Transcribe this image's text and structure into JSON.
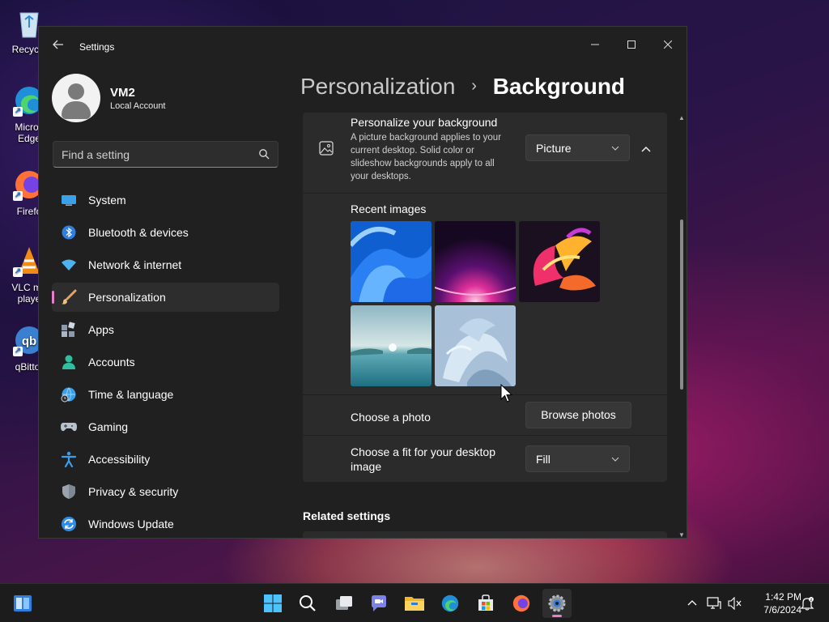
{
  "desktop": {
    "icons": [
      {
        "label": "Recycle"
      },
      {
        "label": "Micros Edge"
      },
      {
        "label": "Firefo"
      },
      {
        "label": "VLC me playe"
      },
      {
        "label": "qBittor"
      }
    ]
  },
  "window": {
    "title": "Settings",
    "controls": {
      "minimize": "—",
      "maximize": "☐",
      "close": "✕"
    }
  },
  "profile": {
    "name": "VM2",
    "account_type": "Local Account"
  },
  "search": {
    "placeholder": "Find a setting"
  },
  "nav": {
    "items": [
      {
        "label": "System",
        "icon": "system-icon"
      },
      {
        "label": "Bluetooth & devices",
        "icon": "bluetooth-icon"
      },
      {
        "label": "Network & internet",
        "icon": "network-icon"
      },
      {
        "label": "Personalization",
        "icon": "brush-icon",
        "active": true
      },
      {
        "label": "Apps",
        "icon": "apps-icon"
      },
      {
        "label": "Accounts",
        "icon": "accounts-icon"
      },
      {
        "label": "Time & language",
        "icon": "time-icon"
      },
      {
        "label": "Gaming",
        "icon": "gaming-icon"
      },
      {
        "label": "Accessibility",
        "icon": "accessibility-icon"
      },
      {
        "label": "Privacy & security",
        "icon": "shield-icon"
      },
      {
        "label": "Windows Update",
        "icon": "update-icon"
      }
    ]
  },
  "breadcrumb": {
    "parent": "Personalization",
    "separator": "›",
    "current": "Background"
  },
  "background": {
    "title": "Personalize your background",
    "description": "A picture background applies to your current desktop. Solid color or slideshow backgrounds apply to all your desktops.",
    "type_value": "Picture",
    "recent_images_title": "Recent images",
    "recent_images": [
      "bloom-blue-wallpaper",
      "glow-purple-wallpaper",
      "flower-colorful-wallpaper",
      "lake-sunrise-wallpaper",
      "bloom-light-wallpaper"
    ],
    "choose_photo_label": "Choose a photo",
    "browse_label": "Browse photos",
    "fit_label": "Choose a fit for your desktop image",
    "fit_value": "Fill"
  },
  "related": {
    "title": "Related settings"
  },
  "taskbar": {
    "clock_time": "1:42 PM",
    "clock_date": "7/6/2024"
  },
  "colors": {
    "accent": "#e77fcf",
    "window_bg": "#202020",
    "card_bg": "#2b2b2b"
  }
}
